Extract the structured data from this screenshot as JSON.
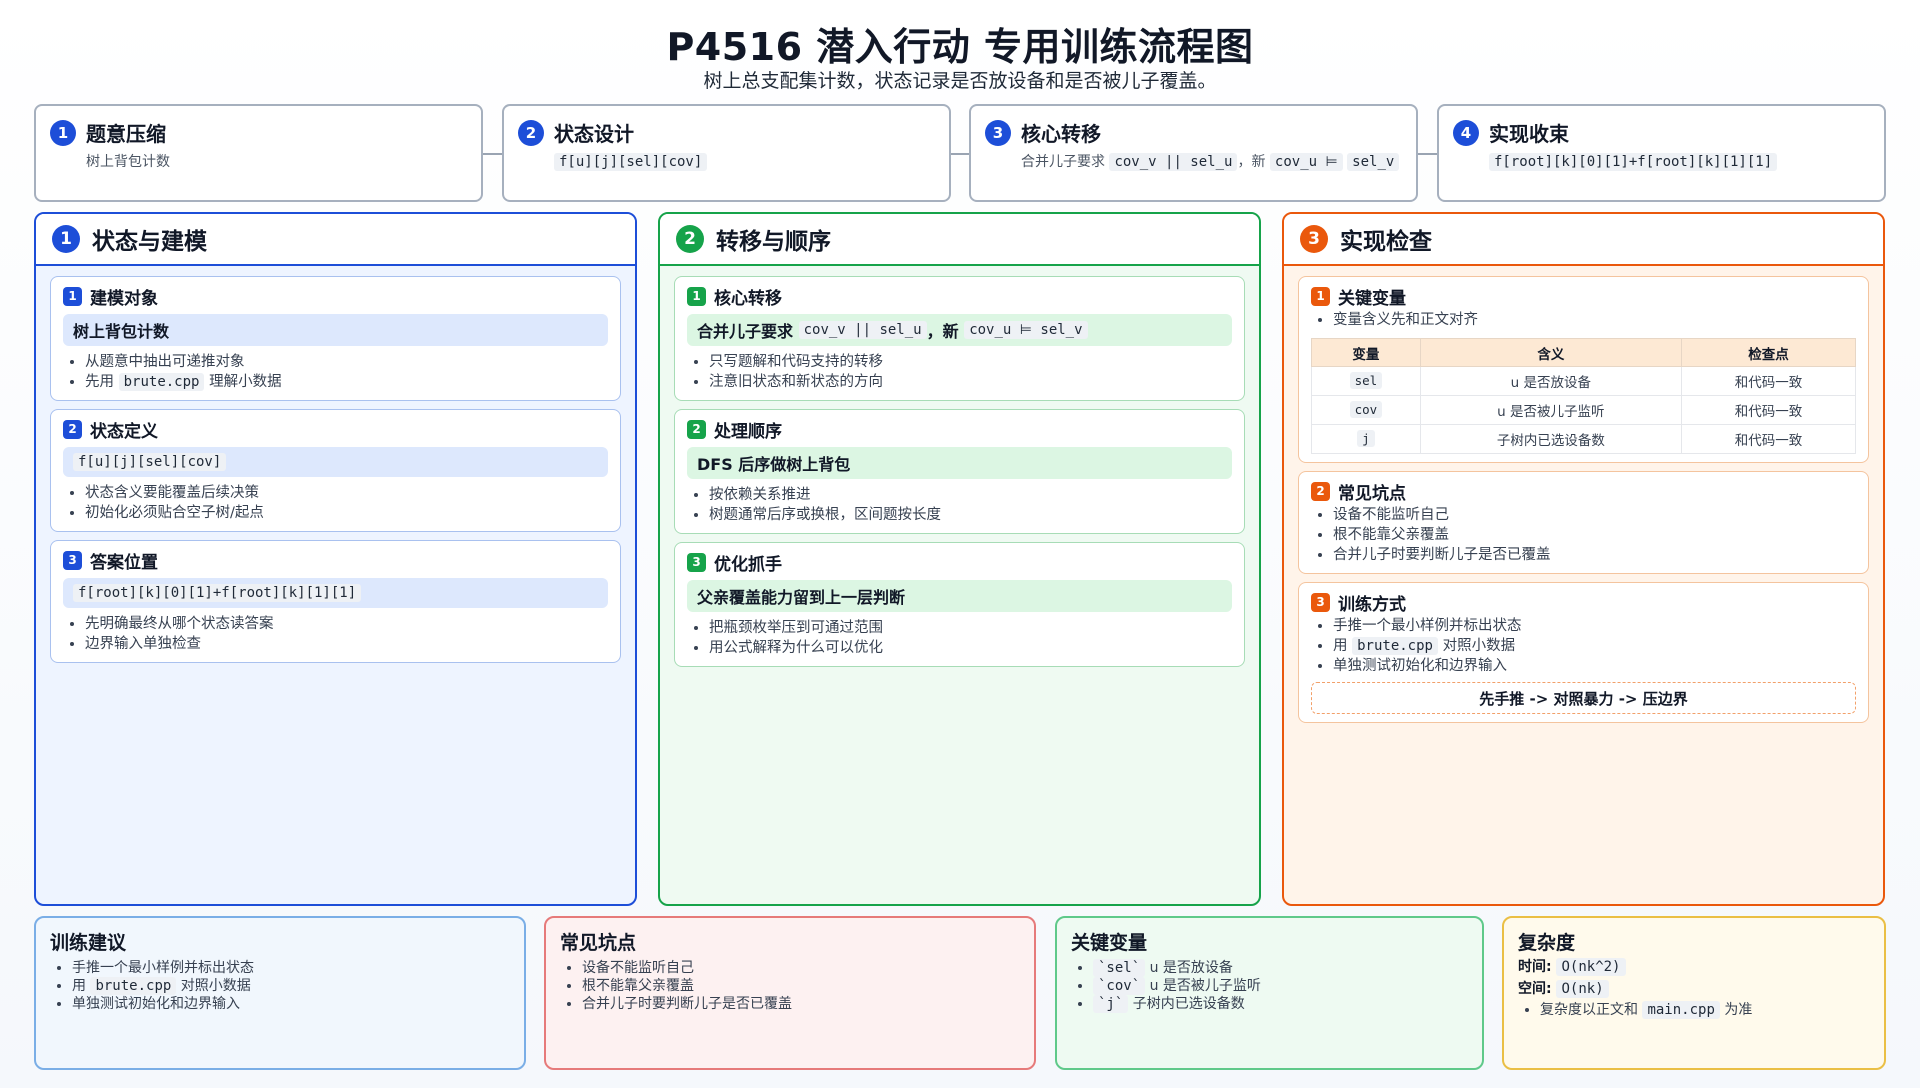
{
  "header": {
    "title": "P4516 潜入行动 专用训练流程图",
    "subtitle": "树上总支配集计数，状态记录是否放设备和是否被儿子覆盖。"
  },
  "steps": [
    {
      "num": "1",
      "title": "题意压缩",
      "desc": "树上背包计数"
    },
    {
      "num": "2",
      "title": "状态设计",
      "code": "f[u][j][sel][cov]"
    },
    {
      "num": "3",
      "title": "核心转移",
      "desc_prefix": "合并儿子要求",
      "code1": "cov_v || sel_u",
      "mid": "，新",
      "code2": "cov_u ⊨",
      "code3": "sel_v"
    },
    {
      "num": "4",
      "title": "实现收束",
      "code": "f[root][k][0][1]+f[root][k][1][1]"
    }
  ],
  "panels": {
    "p1": {
      "num": "1",
      "title": "状态与建模",
      "cards": [
        {
          "num": "1",
          "title": "建模对象",
          "highlight": "树上背包计数",
          "b1": "从题意中抽出可递推对象",
          "b2_pre": "先用",
          "b2_code": "brute.cpp",
          "b2_post": "理解小数据"
        },
        {
          "num": "2",
          "title": "状态定义",
          "highlight_code": "f[u][j][sel][cov]",
          "b1": "状态含义要能覆盖后续决策",
          "b2": "初始化必须贴合空子树/起点"
        },
        {
          "num": "3",
          "title": "答案位置",
          "highlight_code": "f[root][k][0][1]+f[root][k][1][1]",
          "b1": "先明确最终从哪个状态读答案",
          "b2": "边界输入单独检查"
        }
      ]
    },
    "p2": {
      "num": "2",
      "title": "转移与顺序",
      "cards": [
        {
          "num": "1",
          "title": "核心转移",
          "h_pre": "合并儿子要求",
          "h_code1": "cov_v || sel_u",
          "h_mid": "，新",
          "h_code2": "cov_u ⊨ sel_v",
          "b1": "只写题解和代码支持的转移",
          "b2": "注意旧状态和新状态的方向"
        },
        {
          "num": "2",
          "title": "处理顺序",
          "highlight": "DFS 后序做树上背包",
          "b1": "按依赖关系推进",
          "b2": "树题通常后序或换根，区间题按长度"
        },
        {
          "num": "3",
          "title": "优化抓手",
          "highlight": "父亲覆盖能力留到上一层判断",
          "b1": "把瓶颈枚举压到可通过范围",
          "b2": "用公式解释为什么可以优化"
        }
      ]
    },
    "p3": {
      "num": "3",
      "title": "实现检查",
      "card1": {
        "num": "1",
        "title": "关键变量",
        "b1": "变量含义先和正文对齐",
        "table_headers": [
          "变量",
          "含义",
          "检查点"
        ],
        "rows": [
          {
            "var": "sel",
            "meaning": "u 是否放设备",
            "check": "和代码一致"
          },
          {
            "var": "cov",
            "meaning": "u 是否被儿子监听",
            "check": "和代码一致"
          },
          {
            "var": "j",
            "meaning": "子树内已选设备数",
            "check": "和代码一致"
          }
        ]
      },
      "card2": {
        "num": "2",
        "title": "常见坑点",
        "b1": "设备不能监听自己",
        "b2": "根不能靠父亲覆盖",
        "b3": "合并儿子时要判断儿子是否已覆盖"
      },
      "card3": {
        "num": "3",
        "title": "训练方式",
        "b1": "手推一个最小样例并标出状态",
        "b2_pre": "用",
        "b2_code": "brute.cpp",
        "b2_post": "对照小数据",
        "b3": "单独测试初始化和边界输入",
        "flow": "先手推 -> 对照暴力 -> 压边界"
      }
    }
  },
  "bottom": {
    "training": {
      "title": "训练建议",
      "b1": "手推一个最小样例并标出状态",
      "b2_pre": "用",
      "b2_code": "brute.cpp",
      "b2_post": "对照小数据",
      "b3": "单独测试初始化和边界输入"
    },
    "pitfalls": {
      "title": "常见坑点",
      "b1": "设备不能监听自己",
      "b2": "根不能靠父亲覆盖",
      "b3": "合并儿子时要判断儿子是否已覆盖"
    },
    "vars": {
      "title": "关键变量",
      "v1_code": "`sel`",
      "v1": "u 是否放设备",
      "v2_code": "`cov`",
      "v2": "u 是否被儿子监听",
      "v3_code": "`j`",
      "v3": "子树内已选设备数"
    },
    "complexity": {
      "title": "复杂度",
      "time_label": "时间:",
      "time": "O(nk^2)",
      "space_label": "空间:",
      "space": "O(nk)",
      "b1_pre": "复杂度以正文和",
      "b1_code": "main.cpp",
      "b1_post": "为准"
    }
  },
  "colors": {
    "blue": "#1d4ed8",
    "green": "#16a34a",
    "orange": "#ea580c",
    "red": "#dc2626",
    "yellow": "#eab308"
  }
}
